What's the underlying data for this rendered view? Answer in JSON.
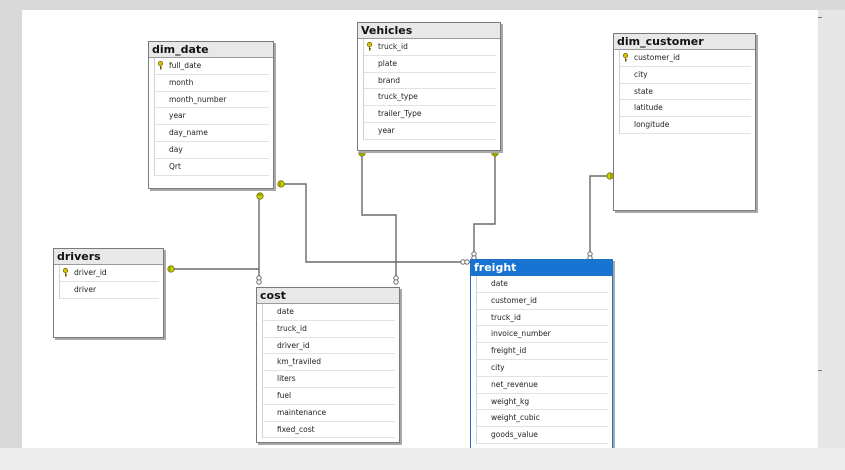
{
  "tables": {
    "dim_date": {
      "title": "dim_date",
      "columns": [
        {
          "name": "full_date",
          "pk": true
        },
        {
          "name": "month"
        },
        {
          "name": "month_number"
        },
        {
          "name": "year"
        },
        {
          "name": "day_name"
        },
        {
          "name": "day"
        },
        {
          "name": "Qrt"
        }
      ]
    },
    "vehicles": {
      "title": "Vehicles",
      "columns": [
        {
          "name": "truck_id",
          "pk": true
        },
        {
          "name": "plate"
        },
        {
          "name": "brand"
        },
        {
          "name": "truck_type"
        },
        {
          "name": "trailer_Type"
        },
        {
          "name": "year"
        }
      ]
    },
    "dim_customer": {
      "title": "dim_customer",
      "columns": [
        {
          "name": "customer_id",
          "pk": true
        },
        {
          "name": "city"
        },
        {
          "name": "state"
        },
        {
          "name": "latitude"
        },
        {
          "name": "longitude"
        }
      ]
    },
    "drivers": {
      "title": "drivers",
      "columns": [
        {
          "name": "driver_id",
          "pk": true
        },
        {
          "name": "driver"
        }
      ]
    },
    "cost": {
      "title": "cost",
      "columns": [
        {
          "name": "date"
        },
        {
          "name": "truck_id"
        },
        {
          "name": "driver_id"
        },
        {
          "name": "km_traviled"
        },
        {
          "name": "liters"
        },
        {
          "name": "fuel"
        },
        {
          "name": "maintenance"
        },
        {
          "name": "fixed_cost"
        }
      ]
    },
    "freight": {
      "title": "freight",
      "selected": true,
      "columns": [
        {
          "name": "date"
        },
        {
          "name": "customer_id"
        },
        {
          "name": "truck_id"
        },
        {
          "name": "invoice_number"
        },
        {
          "name": "freight_id"
        },
        {
          "name": "city"
        },
        {
          "name": "net_revenue"
        },
        {
          "name": "weight_kg"
        },
        {
          "name": "weight_cubic"
        },
        {
          "name": "goods_value"
        }
      ]
    }
  },
  "relationships": [
    {
      "from": "cost",
      "to": "dim_date"
    },
    {
      "from": "freight",
      "to": "dim_date"
    },
    {
      "from": "cost",
      "to": "drivers"
    },
    {
      "from": "cost",
      "to": "vehicles"
    },
    {
      "from": "freight",
      "to": "vehicles"
    },
    {
      "from": "freight",
      "to": "dim_customer"
    }
  ],
  "colors": {
    "selected_header": "#1874d2",
    "connector": "#666666",
    "key_endpoint": "#c9d400"
  }
}
